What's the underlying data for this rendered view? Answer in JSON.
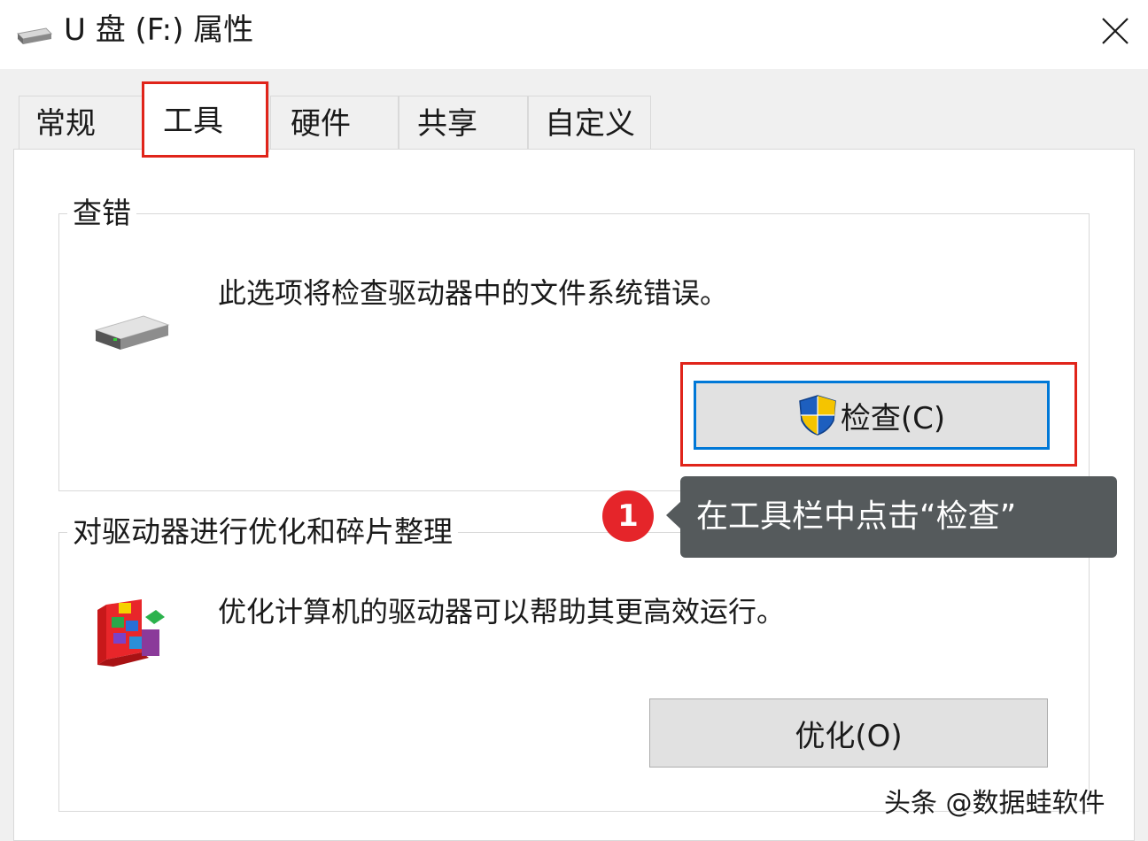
{
  "window": {
    "title": "U 盘 (F:) 属性",
    "icon": "usb-drive-icon",
    "close_icon": "close-icon"
  },
  "tabs": [
    {
      "label": "常规",
      "active": false
    },
    {
      "label": "工具",
      "active": true
    },
    {
      "label": "硬件",
      "active": false
    },
    {
      "label": "共享",
      "active": false
    },
    {
      "label": "自定义",
      "active": false
    }
  ],
  "error_check": {
    "group_title": "查错",
    "description": "此选项将检查驱动器中的文件系统错误。",
    "icon": "drive-icon",
    "button_icon": "uac-shield-icon",
    "button_label": "检查(C)"
  },
  "optimize": {
    "group_title": "对驱动器进行优化和碎片整理",
    "description": "优化计算机的驱动器可以帮助其更高效运行。",
    "icon": "defrag-icon",
    "button_label": "优化(O)"
  },
  "annotation": {
    "step_number": "1",
    "callout_text": "在工具栏中点击“检查”",
    "highlight_color": "#e0241a",
    "badge_color": "#e5252a"
  },
  "watermark": "头条 @数据蛙软件",
  "colors": {
    "focus_border": "#0078d7",
    "panel_bg": "#ffffff",
    "window_bg": "#f0f0f0"
  }
}
